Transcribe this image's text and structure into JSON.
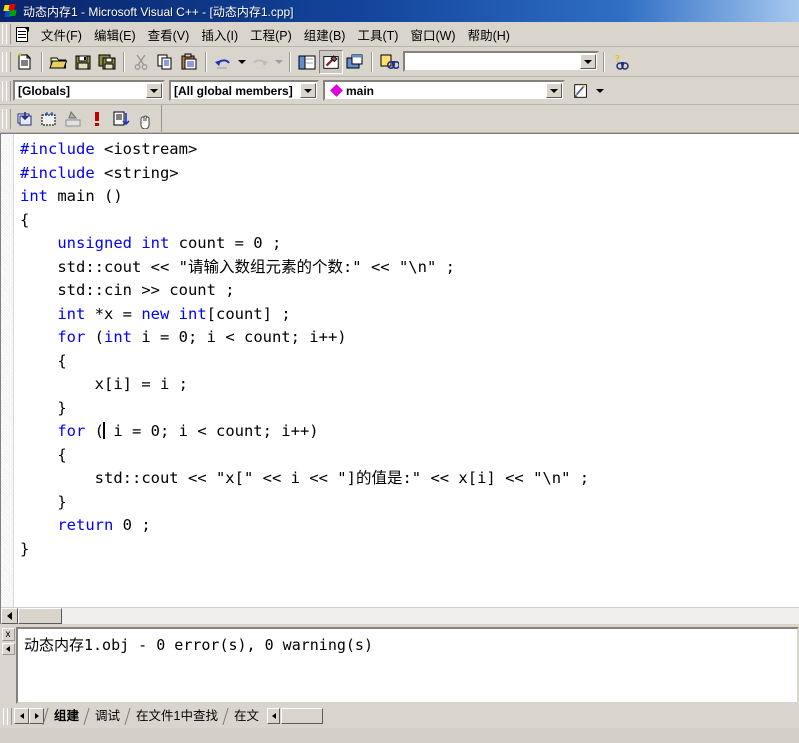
{
  "window": {
    "title": "动态内存1 - Microsoft Visual C++ - [动态内存1.cpp]",
    "app_icon": "visual-cpp-icon"
  },
  "menu": {
    "items": [
      {
        "label": "文件(F)"
      },
      {
        "label": "编辑(E)"
      },
      {
        "label": "查看(V)"
      },
      {
        "label": "插入(I)"
      },
      {
        "label": "工程(P)"
      },
      {
        "label": "组建(B)"
      },
      {
        "label": "工具(T)"
      },
      {
        "label": "窗口(W)"
      },
      {
        "label": "帮助(H)"
      }
    ]
  },
  "standard_toolbar": {
    "buttons": [
      "new-document-icon",
      "open-folder-icon",
      "save-icon",
      "save-all-icon",
      "cut-scissors-icon",
      "copy-icon",
      "paste-icon",
      "undo-icon",
      "undo-dropdown-icon",
      "redo-icon",
      "redo-dropdown-icon",
      "workspace-icon",
      "output-window-icon",
      "window-list-icon",
      "find-in-files-icon",
      "find-help-icon"
    ],
    "find_box_value": "",
    "find_box_placeholder": ""
  },
  "wizard_bar": {
    "class_combo": "[Globals]",
    "members_combo": "[All global members]",
    "function_combo": "main",
    "function_icon": "member-diamond-icon",
    "action_icon": "wizardbar-actions-icon"
  },
  "build_toolbar": {
    "buttons": [
      "compile-icon",
      "build-icon",
      "stop-build-icon",
      "execute-icon",
      "go-icon",
      "insert-breakpoint-icon"
    ]
  },
  "editor": {
    "lines": [
      [
        {
          "t": "#include",
          "c": "kw"
        },
        {
          "t": " <iostream>",
          "c": ""
        }
      ],
      [
        {
          "t": "#include",
          "c": "kw"
        },
        {
          "t": " <string>",
          "c": ""
        }
      ],
      [
        {
          "t": "int",
          "c": "kw"
        },
        {
          "t": " main ()",
          "c": ""
        }
      ],
      [
        {
          "t": "{",
          "c": ""
        }
      ],
      [
        {
          "t": "",
          "c": ""
        }
      ],
      [
        {
          "t": "    ",
          "c": ""
        },
        {
          "t": "unsigned int",
          "c": "kw"
        },
        {
          "t": " count = 0 ;",
          "c": ""
        }
      ],
      [
        {
          "t": "    std::cout << \"请输入数组元素的个数:\" << \"\\n\" ;",
          "c": ""
        }
      ],
      [
        {
          "t": "    std::cin >> count ;",
          "c": ""
        }
      ],
      [
        {
          "t": "    ",
          "c": ""
        },
        {
          "t": "int",
          "c": "kw"
        },
        {
          "t": " *x = ",
          "c": ""
        },
        {
          "t": "new",
          "c": "kw"
        },
        {
          "t": " ",
          "c": ""
        },
        {
          "t": "int",
          "c": "kw"
        },
        {
          "t": "[count] ;",
          "c": ""
        }
      ],
      [
        {
          "t": "",
          "c": ""
        }
      ],
      [
        {
          "t": "    ",
          "c": ""
        },
        {
          "t": "for",
          "c": "kw"
        },
        {
          "t": " (",
          "c": ""
        },
        {
          "t": "int",
          "c": "kw"
        },
        {
          "t": " i = 0; i < count; i++)",
          "c": ""
        }
      ],
      [
        {
          "t": "    {",
          "c": ""
        }
      ],
      [
        {
          "t": "        x[i] = i ;",
          "c": ""
        }
      ],
      [
        {
          "t": "    }",
          "c": ""
        }
      ],
      [
        {
          "t": "    ",
          "c": ""
        },
        {
          "t": "for",
          "c": "kw"
        },
        {
          "t": " (",
          "c": ""
        },
        {
          "t": "|CARET|",
          "c": "caret"
        },
        {
          "t": " i = 0; i < count; i++)",
          "c": ""
        }
      ],
      [
        {
          "t": "    {",
          "c": ""
        }
      ],
      [
        {
          "t": "        std::cout << \"x[\" << i << \"]的值是:\" << x[i] << \"\\n\" ;",
          "c": ""
        }
      ],
      [
        {
          "t": "    }",
          "c": ""
        }
      ],
      [
        {
          "t": "",
          "c": ""
        }
      ],
      [
        {
          "t": "    ",
          "c": ""
        },
        {
          "t": "return",
          "c": "kw"
        },
        {
          "t": " 0 ;",
          "c": ""
        }
      ],
      [
        {
          "t": "}",
          "c": ""
        }
      ]
    ],
    "keyword_color": "#0000ff",
    "text_color": "#000000",
    "background": "#ffffff"
  },
  "output": {
    "text": "动态内存1.obj - 0 error(s), 0 warning(s)",
    "close_label": "x"
  },
  "bottom_tabs": {
    "tabs": [
      {
        "label": "组建",
        "active": true
      },
      {
        "label": "调试",
        "active": false
      },
      {
        "label": "在文件1中查找",
        "active": false
      },
      {
        "label": "在文",
        "active": false
      }
    ]
  }
}
